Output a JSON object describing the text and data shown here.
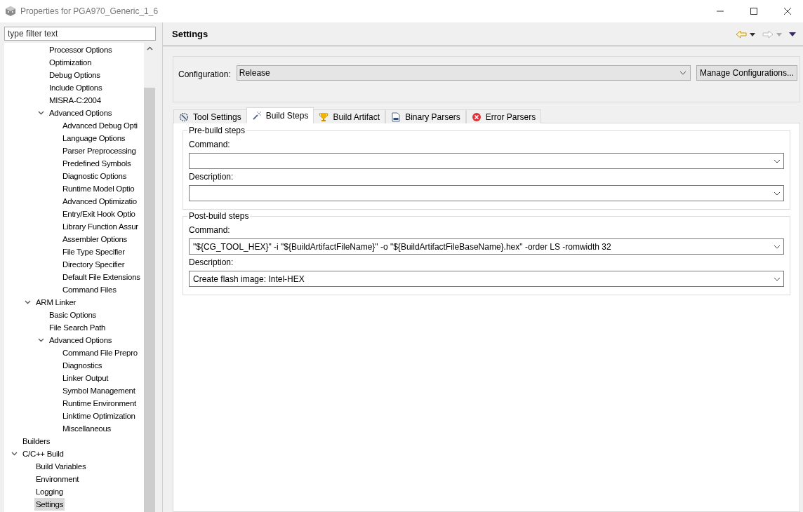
{
  "window": {
    "title": "Properties for PGA970_Generic_1_6"
  },
  "filter": {
    "placeholder": "type filter text"
  },
  "tree": [
    {
      "children": [
        {
          "children": [
            {
              "label": "Processor Options",
              "selected": false
            },
            {
              "label": "Optimization",
              "selected": false
            },
            {
              "label": "Debug Options",
              "selected": false
            },
            {
              "label": "Include Options",
              "selected": false
            },
            {
              "label": "MISRA-C:2004",
              "selected": false
            },
            {
              "label": "Advanced Options",
              "selected": false,
              "expanded": true,
              "children": [
                {
                  "label": "Advanced Debug Opti",
                  "selected": false
                },
                {
                  "label": "Language Options",
                  "selected": false
                },
                {
                  "label": "Parser Preprocessing",
                  "selected": false
                },
                {
                  "label": "Predefined Symbols",
                  "selected": false
                },
                {
                  "label": "Diagnostic Options",
                  "selected": false
                },
                {
                  "label": "Runtime Model Optio",
                  "selected": false
                },
                {
                  "label": "Advanced Optimizatio",
                  "selected": false
                },
                {
                  "label": "Entry/Exit Hook Optio",
                  "selected": false
                },
                {
                  "label": "Library Function Assur",
                  "selected": false
                },
                {
                  "label": "Assembler Options",
                  "selected": false
                },
                {
                  "label": "File Type Specifier",
                  "selected": false
                },
                {
                  "label": "Directory Specifier",
                  "selected": false
                },
                {
                  "label": "Default File Extensions",
                  "selected": false
                },
                {
                  "label": "Command Files",
                  "selected": false
                }
              ]
            }
          ]
        },
        {
          "label": "ARM Linker",
          "selected": false,
          "expanded": true,
          "children": [
            {
              "label": "Basic Options",
              "selected": false
            },
            {
              "label": "File Search Path",
              "selected": false
            },
            {
              "label": "Advanced Options",
              "selected": false,
              "expanded": true,
              "children": [
                {
                  "label": "Command File Prepro",
                  "selected": false
                },
                {
                  "label": "Diagnostics",
                  "selected": false
                },
                {
                  "label": "Linker Output",
                  "selected": false
                },
                {
                  "label": "Symbol Management",
                  "selected": false
                },
                {
                  "label": "Runtime Environment",
                  "selected": false
                },
                {
                  "label": "Linktime Optimization",
                  "selected": false
                },
                {
                  "label": "Miscellaneous",
                  "selected": false
                }
              ]
            }
          ]
        }
      ]
    },
    {
      "label": "Builders",
      "selected": false
    },
    {
      "label": "C/C++ Build",
      "selected": false,
      "expanded": true,
      "children": [
        {
          "label": "Build Variables",
          "selected": false
        },
        {
          "label": "Environment",
          "selected": false
        },
        {
          "label": "Logging",
          "selected": false
        },
        {
          "label": "Settings",
          "selected": true
        }
      ]
    }
  ],
  "page": {
    "title": "Settings"
  },
  "configuration": {
    "label": "Configuration:",
    "value": "Release",
    "button": "Manage Configurations..."
  },
  "tabs": [
    {
      "label": "Tool Settings",
      "kind": "tool",
      "selected": false
    },
    {
      "label": "Build Steps",
      "kind": "steps",
      "selected": true
    },
    {
      "label": "Build Artifact",
      "kind": "artifact",
      "selected": false
    },
    {
      "label": "Binary Parsers",
      "kind": "binary",
      "selected": false
    },
    {
      "label": "Error Parsers",
      "kind": "error",
      "selected": false
    }
  ],
  "groups": [
    {
      "title": "Pre-build steps",
      "fields": [
        {
          "label": "Command:"
        },
        {
          "label": "Description:"
        }
      ]
    },
    {
      "title": "Post-build steps",
      "fields": [
        {
          "label": "Command:",
          "value": "\"${CG_TOOL_HEX}\" -i \"${BuildArtifactFileName}\" -o \"${BuildArtifactFileBaseName}.hex\" -order LS -romwidth 32"
        },
        {
          "label": "Description:",
          "value": "Create flash image: Intel-HEX"
        }
      ]
    }
  ]
}
